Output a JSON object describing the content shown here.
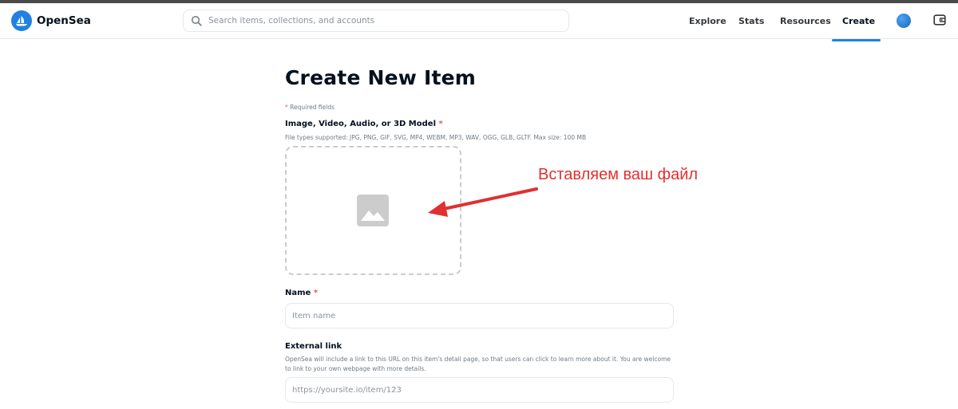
{
  "header": {
    "brand": "OpenSea",
    "search_placeholder": "Search items, collections, and accounts",
    "nav": [
      "Explore",
      "Stats",
      "Resources",
      "Create"
    ],
    "active_nav": "Create",
    "accent_color": "#2081e2"
  },
  "form": {
    "title": "Create New Item",
    "required_note": "Required fields",
    "media_label": "Image, Video, Audio, or 3D Model",
    "media_help": "File types supported: JPG, PNG, GIF, SVG, MP4, WEBM, MP3, WAV, OGG, GLB, GLTF. Max size: 100 MB",
    "media_icon": "image-placeholder-icon",
    "name_label": "Name",
    "name_placeholder": "Item name",
    "external_label": "External link",
    "external_help": "OpenSea will include a link to this URL on this item's detail page, so that users can click to learn more about it. You are welcome to link to your own webpage with more details.",
    "external_placeholder": "https://yoursite.io/item/123",
    "required_star": "*"
  },
  "annotation": {
    "text": "Вставляем ваш файл",
    "color": "#e03030"
  }
}
